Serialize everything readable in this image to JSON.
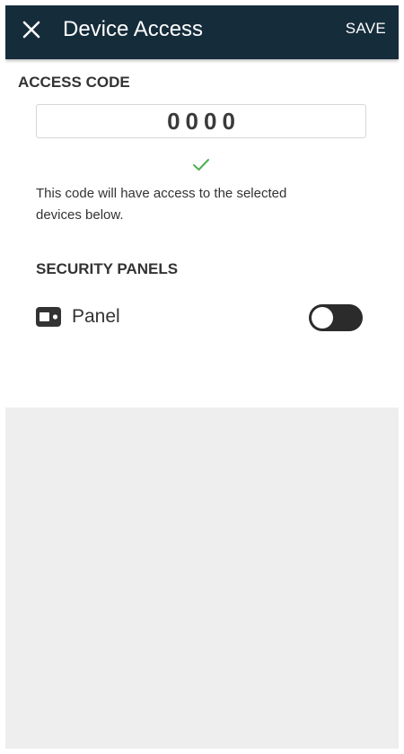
{
  "app_bar": {
    "title": "Device Access",
    "save_label": "SAVE",
    "close_icon": "close-icon"
  },
  "access_code": {
    "heading": "ACCESS CODE",
    "value": "0000",
    "valid_icon": "check-icon",
    "help_text": "This code will have access to the selected devices below."
  },
  "security_panels": {
    "heading": "SECURITY PANELS",
    "items": [
      {
        "label": "Panel",
        "icon": "security-panel-icon",
        "enabled": false
      }
    ]
  },
  "colors": {
    "app_bar": "#152c3b",
    "check": "#4caf50",
    "toggle_track": "#2b2b2b",
    "background": "#eeeeee"
  }
}
